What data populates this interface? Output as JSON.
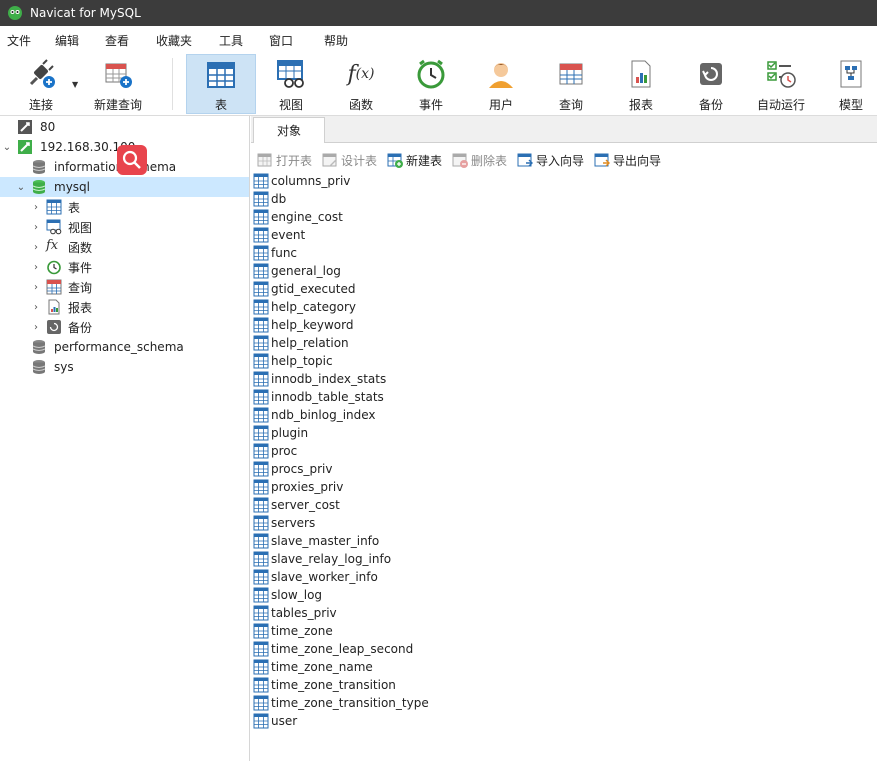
{
  "window": {
    "title": "Navicat for MySQL"
  },
  "menu": [
    "文件",
    "编辑",
    "查看",
    "收藏夹",
    "工具",
    "窗口",
    "帮助"
  ],
  "toolbar": {
    "connect_label": "连接",
    "new_query_label": "新建查询",
    "items": [
      "表",
      "视图",
      "函数",
      "事件",
      "用户",
      "查询",
      "报表",
      "备份",
      "自动运行",
      "模型"
    ],
    "active": "表"
  },
  "tree": {
    "connections": [
      {
        "label": "80"
      },
      {
        "label": "192.168.30.100"
      }
    ],
    "databases": [
      "information_schema",
      "mysql",
      "performance_schema",
      "sys"
    ],
    "selected_db": "mysql",
    "mysql_children": [
      "表",
      "视图",
      "函数",
      "事件",
      "查询",
      "报表",
      "备份"
    ]
  },
  "tabs": {
    "objects_label": "对象"
  },
  "object_toolbar": {
    "open_table": "打开表",
    "design_table": "设计表",
    "new_table": "新建表",
    "delete_table": "删除表",
    "import_wizard": "导入向导",
    "export_wizard": "导出向导"
  },
  "tables": [
    "columns_priv",
    "db",
    "engine_cost",
    "event",
    "func",
    "general_log",
    "gtid_executed",
    "help_category",
    "help_keyword",
    "help_relation",
    "help_topic",
    "innodb_index_stats",
    "innodb_table_stats",
    "ndb_binlog_index",
    "plugin",
    "proc",
    "procs_priv",
    "proxies_priv",
    "server_cost",
    "servers",
    "slave_master_info",
    "slave_relay_log_info",
    "slave_worker_info",
    "slow_log",
    "tables_priv",
    "time_zone",
    "time_zone_leap_second",
    "time_zone_name",
    "time_zone_transition",
    "time_zone_transition_type",
    "user"
  ],
  "colors": {
    "titlebar": "#3c3c3c",
    "selection": "#cce8ff",
    "toolbar_active": "#cde3f5",
    "accent": "#1a73c8"
  }
}
